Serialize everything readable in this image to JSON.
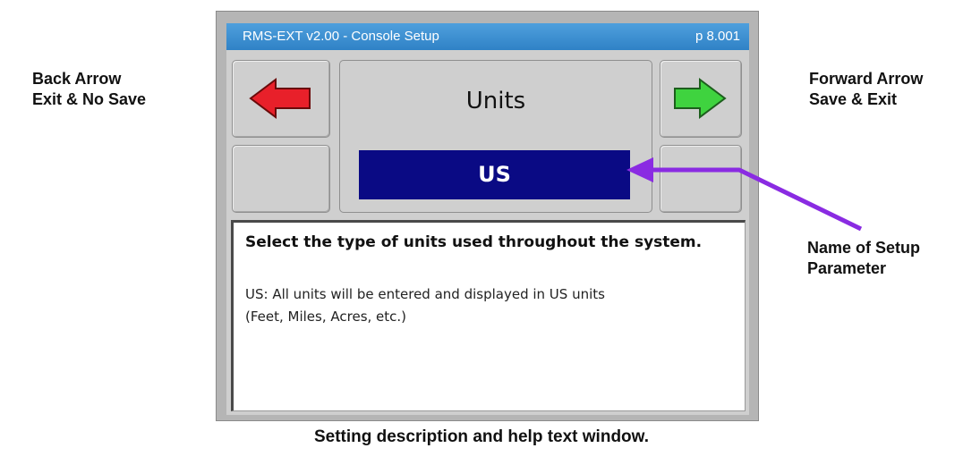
{
  "annotations": {
    "back_arrow": [
      "Back Arrow",
      "Exit & No Save"
    ],
    "forward_arrow": [
      "Forward Arrow",
      "Save & Exit"
    ],
    "setup_parameter": [
      "Name of Setup",
      "Parameter"
    ],
    "help_caption": "Setting description and help text window."
  },
  "titlebar": {
    "title": "RMS-EXT v2.00 - Console Setup",
    "page": "p 8.001"
  },
  "parameter": {
    "name": "Units",
    "value": "US"
  },
  "help": {
    "heading": "Select the type of units used throughout the system.",
    "body_lines": [
      "US: All units will be entered and displayed in US units",
      "(Feet, Miles, Acres, etc.)"
    ]
  },
  "colors": {
    "titlebar": "#3d92d4",
    "value_box": "#0a0a84",
    "back_arrow": "#e8202a",
    "forward_arrow": "#3fd33f",
    "annotation_arrow": "#8a2be2"
  },
  "icons": {
    "back": "left-arrow-icon",
    "forward": "right-arrow-icon"
  }
}
